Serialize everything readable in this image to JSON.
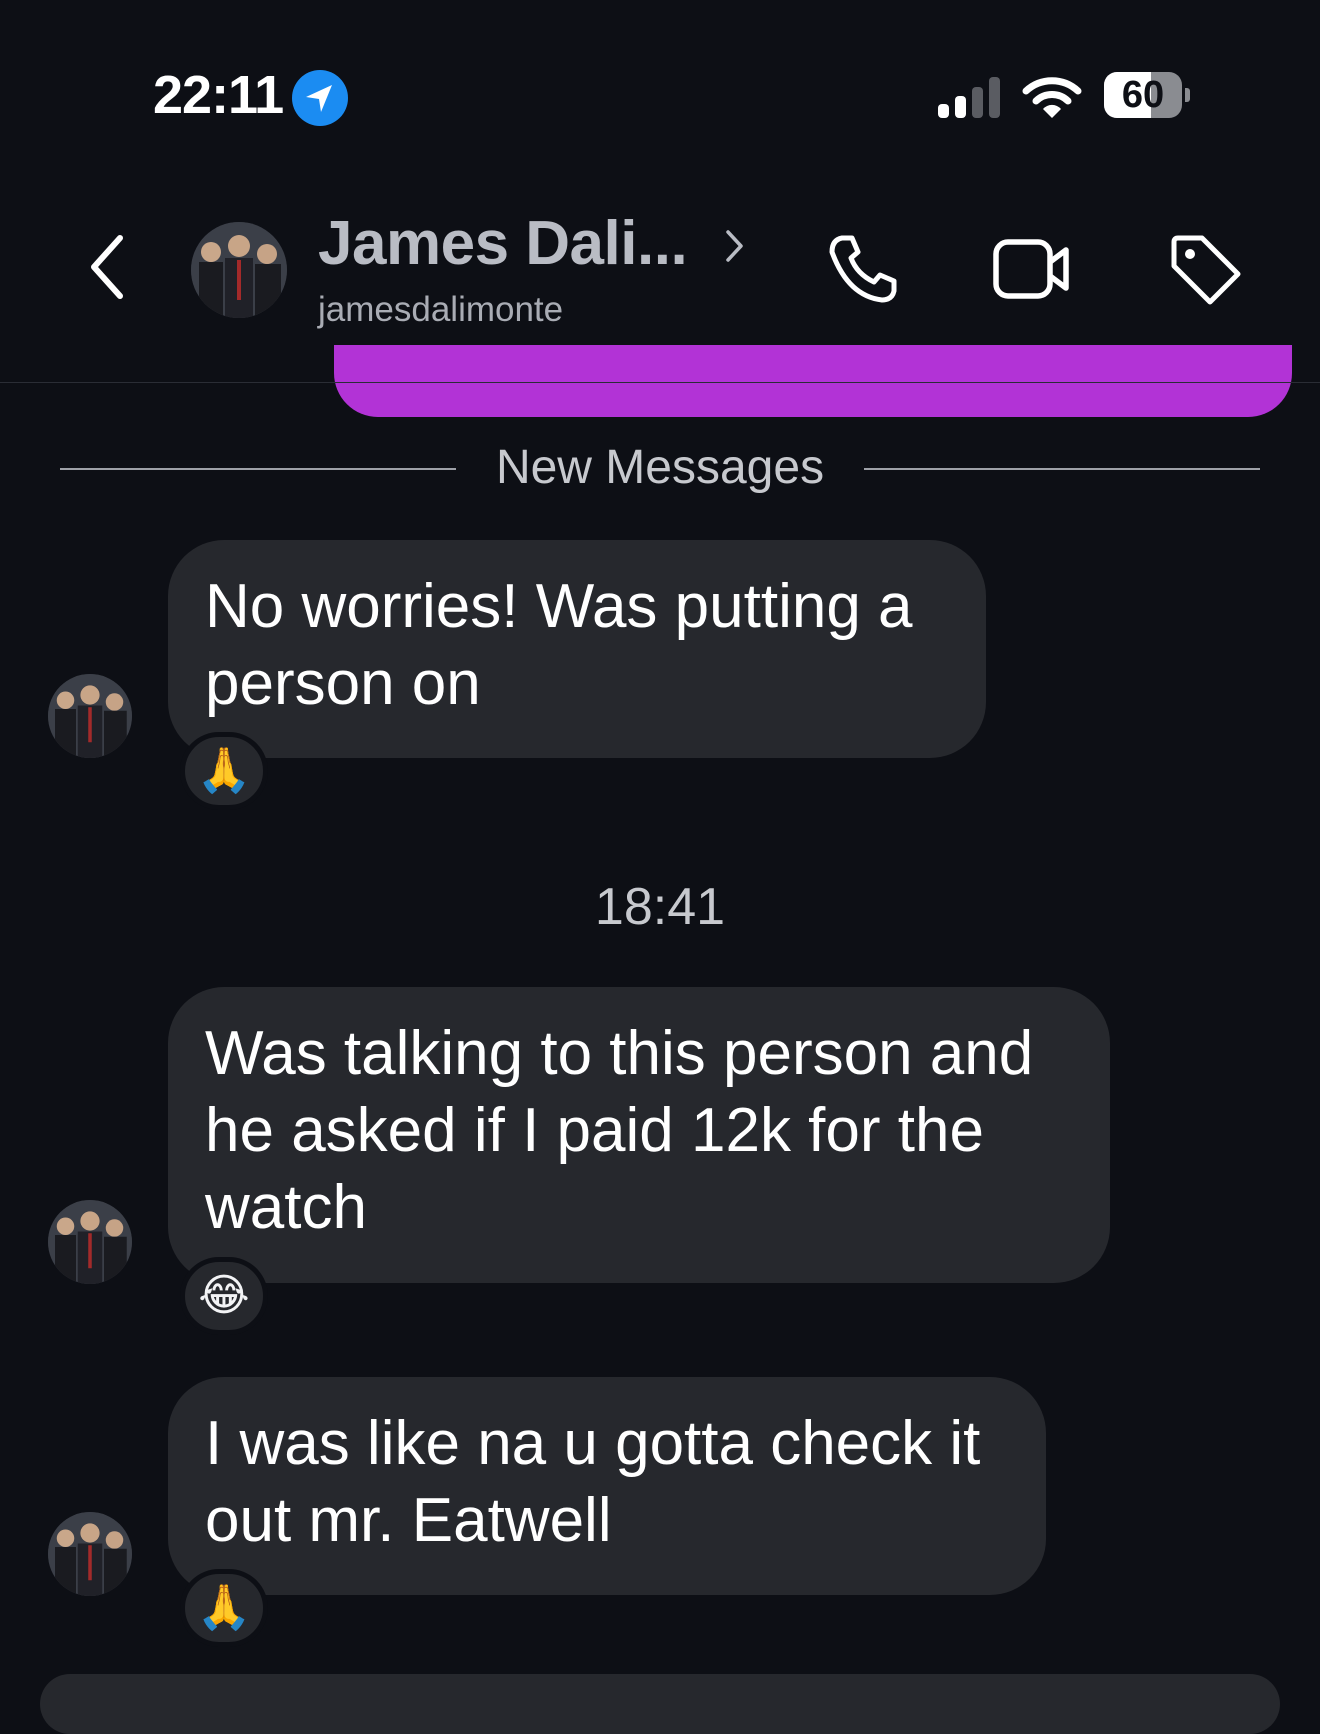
{
  "status_bar": {
    "time": "22:11",
    "location_icon": "location-arrow-icon",
    "signal_bars": 2,
    "signal_icon": "cellular-signal-icon",
    "wifi_icon": "wifi-icon",
    "battery_percent": "60",
    "battery_level": 0.6
  },
  "header": {
    "back_icon": "chevron-left-icon",
    "name": "James Dali...",
    "name_chevron_icon": "chevron-right-icon",
    "username": "jamesdalimonte",
    "call_icon": "phone-icon",
    "video_icon": "video-camera-icon",
    "tag_icon": "tag-icon"
  },
  "colors": {
    "background": "#0d0f15",
    "bubble": "#26282d",
    "own_bubble": "#b233d6",
    "location_blue": "#1b8cf2"
  },
  "divider": {
    "label": "New Messages"
  },
  "timestamp": "18:41",
  "messages": [
    {
      "text": "No worries! Was putting a person on",
      "reaction": "🙏"
    },
    {
      "text": "Was talking to this person and he asked if I paid 12k for the watch",
      "reaction": "😂"
    },
    {
      "text": "I was like na u gotta check it out mr. Eatwell",
      "reaction": "🙏"
    }
  ]
}
